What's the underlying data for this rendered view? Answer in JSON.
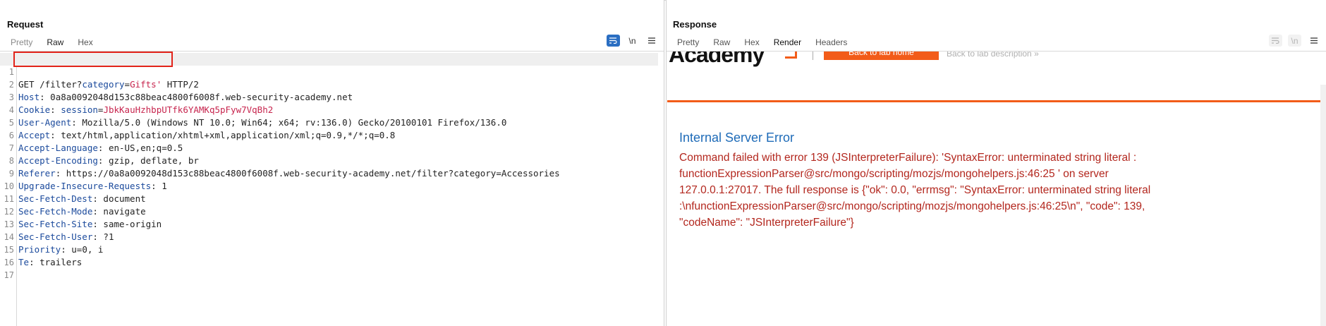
{
  "layout_toggles": [
    "side-by-side-icon",
    "stacked-icon",
    "single-icon"
  ],
  "request": {
    "title": "Request",
    "tabs": [
      {
        "label": "Pretty",
        "state": "muted"
      },
      {
        "label": "Raw",
        "state": "active"
      },
      {
        "label": "Hex",
        "state": "normal"
      }
    ],
    "tools": {
      "wrap_icon": "wrap-icon",
      "newline_label": "\\n",
      "menu_icon": "menu-icon"
    },
    "lines": [
      {
        "n": "1",
        "method": "GET",
        "path": "/filter",
        "q": "?",
        "param": "category",
        "eq": "=",
        "value": "Gifts'",
        "tail": " HTTP/2"
      },
      {
        "n": "2",
        "name": "Host",
        "value": "0a8a0092048d153c88beac4800f6008f.web-security-academy.net"
      },
      {
        "n": "3",
        "name": "Cookie",
        "cookie_name": "session",
        "cookie_value": "JbkKauHzhbpUTfk6YAMKq5pFyw7VqBh2"
      },
      {
        "n": "4",
        "name": "User-Agent",
        "value": "Mozilla/5.0 (Windows NT 10.0; Win64; x64; rv:136.0) Gecko/20100101 Firefox/136.0"
      },
      {
        "n": "5",
        "name": "Accept",
        "value": "text/html,application/xhtml+xml,application/xml;q=0.9,*/*;q=0.8"
      },
      {
        "n": "6",
        "name": "Accept-Language",
        "value": "en-US,en;q=0.5"
      },
      {
        "n": "7",
        "name": "Accept-Encoding",
        "value": "gzip, deflate, br"
      },
      {
        "n": "8",
        "name": "Referer",
        "value": "https://0a8a0092048d153c88beac4800f6008f.web-security-academy.net/filter?category=Accessories"
      },
      {
        "n": "9",
        "name": "Upgrade-Insecure-Requests",
        "value": "1"
      },
      {
        "n": "10",
        "name": "Sec-Fetch-Dest",
        "value": "document"
      },
      {
        "n": "11",
        "name": "Sec-Fetch-Mode",
        "value": "navigate"
      },
      {
        "n": "12",
        "name": "Sec-Fetch-Site",
        "value": "same-origin"
      },
      {
        "n": "13",
        "name": "Sec-Fetch-User",
        "value": "?1"
      },
      {
        "n": "14",
        "name": "Priority",
        "value": "u=0, i"
      },
      {
        "n": "15",
        "name": "Te",
        "value": "trailers"
      },
      {
        "n": "16"
      },
      {
        "n": "17"
      }
    ]
  },
  "response": {
    "title": "Response",
    "tabs": [
      {
        "label": "Pretty",
        "state": "normal"
      },
      {
        "label": "Raw",
        "state": "normal"
      },
      {
        "label": "Hex",
        "state": "normal"
      },
      {
        "label": "Render",
        "state": "selected"
      },
      {
        "label": "Headers",
        "state": "normal"
      }
    ],
    "tools": {
      "wrap_icon": "wrap-icon",
      "newline_label": "\\n",
      "menu_icon": "menu-icon"
    },
    "render": {
      "logo_text": "Academy",
      "back_button": "Back to lab home",
      "back_description": "Back to lab description »",
      "error_title": "Internal Server Error",
      "error_message": " Command failed with error 139 (JSInterpreterFailure): 'SyntaxError: unterminated string literal : functionExpressionParser@src/mongo/scripting/mozjs/mongohelpers.js:46:25 ' on server 127.0.0.1:27017. The full response is {\"ok\": 0.0, \"errmsg\": \"SyntaxError: unterminated string literal :\\nfunctionExpressionParser@src/mongo/scripting/mozjs/mongohelpers.js:46:25\\n\", \"code\": 139, \"codeName\": \"JSInterpreterFailure\"}"
    }
  },
  "colors": {
    "accent": "#2a6ec2",
    "brand_orange": "#f25c19",
    "error_red": "#b3271e",
    "header_name": "#1b4a9c",
    "highlight_box": "#e2231a"
  }
}
